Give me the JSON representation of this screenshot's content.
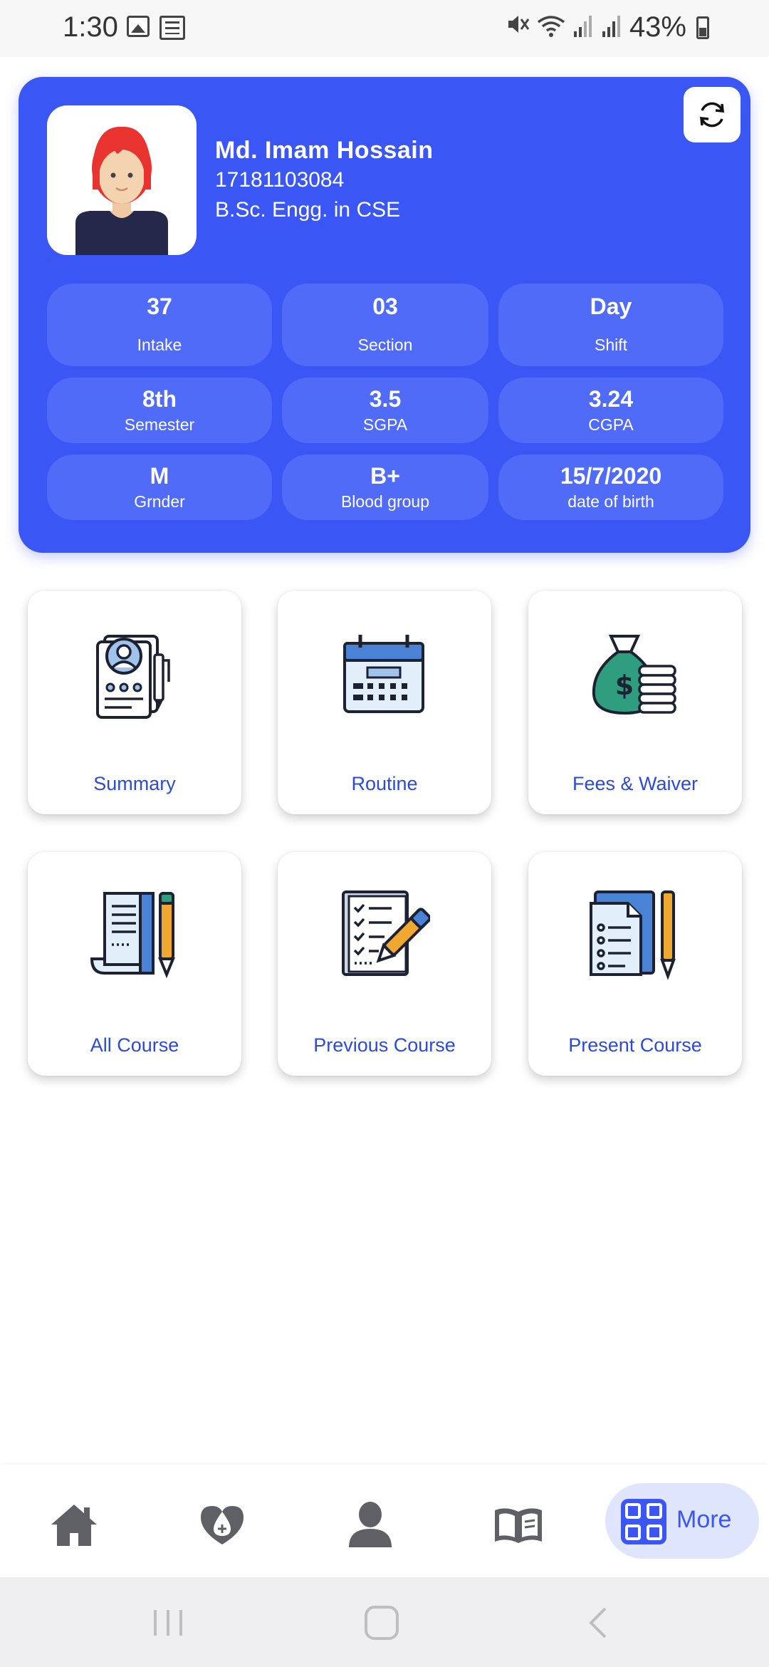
{
  "status_bar": {
    "time": "1:30",
    "battery": "43%",
    "icons": [
      "image-icon",
      "news-icon",
      "mute-icon",
      "wifi-icon",
      "signal-icon",
      "signal-icon",
      "battery-icon"
    ]
  },
  "profile": {
    "name": "Md. Imam Hossain",
    "id": "17181103084",
    "department": "B.Sc. Engg. in CSE",
    "refresh_icon": "refresh-icon",
    "stats": [
      {
        "value": "37",
        "label": "Intake"
      },
      {
        "value": "03",
        "label": "Section"
      },
      {
        "value": "Day",
        "label": "Shift"
      },
      {
        "value": "8th",
        "label": "Semester"
      },
      {
        "value": "3.5",
        "label": "SGPA"
      },
      {
        "value": "3.24",
        "label": "CGPA"
      },
      {
        "value": "M",
        "label": "Grnder"
      },
      {
        "value": "B+",
        "label": "Blood group"
      },
      {
        "value": "15/7/2020",
        "label": "date of birth"
      }
    ]
  },
  "menu": {
    "tiles": [
      {
        "label": "Summary",
        "icon": "resume-icon"
      },
      {
        "label": "Routine",
        "icon": "calendar-icon"
      },
      {
        "label": "Fees & Waiver",
        "icon": "money-bag-icon"
      },
      {
        "label": "All Course",
        "icon": "document-pencil-icon"
      },
      {
        "label": "Previous Course",
        "icon": "checklist-icon"
      },
      {
        "label": "Present Course",
        "icon": "clipboard-list-icon"
      }
    ]
  },
  "bottom_nav": {
    "items": [
      {
        "icon": "home-icon"
      },
      {
        "icon": "blood-drop-icon"
      },
      {
        "icon": "user-icon"
      },
      {
        "icon": "book-icon"
      }
    ],
    "more_label": "More",
    "more_icon": "grid-icon"
  },
  "colors": {
    "accent": "#3a56f5",
    "tile_label": "#2d4ad8",
    "stat_pill": "#4f6bf8"
  }
}
